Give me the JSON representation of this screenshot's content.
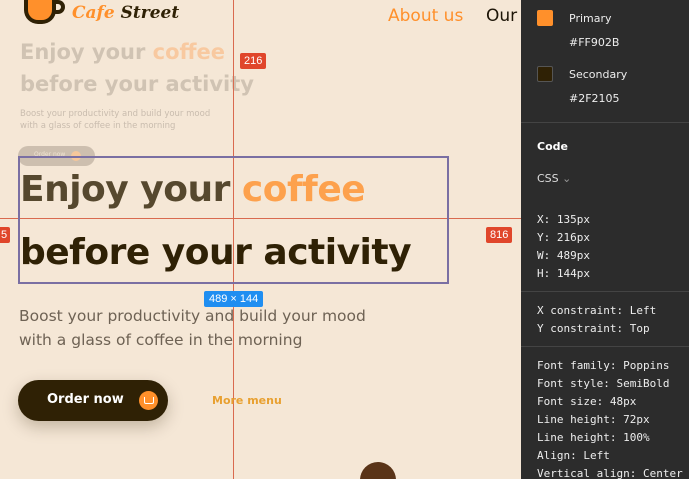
{
  "canvas": {
    "logo": {
      "word1": "Cafe",
      "word2": "Street"
    },
    "nav": {
      "about": "About us",
      "our": "Our"
    },
    "ghost": {
      "title_a": "Enjoy your ",
      "title_hl": "coffee",
      "title_b": "before your activity",
      "subtitle": "Boost your productivity and build your mood with a glass of coffee in the morning",
      "button": "Order now"
    },
    "hero": {
      "title_a": "Enjoy your ",
      "title_hl": "coffee",
      "title_b": "before your activity",
      "subtitle": "Boost your productivity and build your mood with a glass of coffee in the morning",
      "order_button": "Order now",
      "more_link": "More menu"
    },
    "measure": {
      "top": "216",
      "right": "816",
      "left": "5",
      "size": "489 × 144"
    }
  },
  "panel": {
    "colors": [
      {
        "name": "Primary",
        "hex": "#FF902B"
      },
      {
        "name": "Secondary",
        "hex": "#2F2105"
      }
    ],
    "code_heading": "Code",
    "lang": "CSS",
    "pos": [
      "X: 135px",
      "Y: 216px",
      "W: 489px",
      "H: 144px"
    ],
    "constraints": [
      "X constraint: Left",
      "Y constraint: Top"
    ],
    "font": [
      "Font family: Poppins",
      "Font style: SemiBold",
      "Font size: 48px",
      "Line height: 72px",
      "Line height: 100%",
      "Align: Left",
      "Vertical align: Center"
    ]
  },
  "theme": {
    "primary": "#FF902B",
    "secondary": "#2F2105",
    "background": "#F5E7D6",
    "guide": "#E0462B",
    "selection_badge": "#1F8EF1"
  },
  "icons": {
    "logo": "coffee-cup-icon",
    "cart": "cart-icon",
    "dropdown": "chevron-down-icon"
  }
}
